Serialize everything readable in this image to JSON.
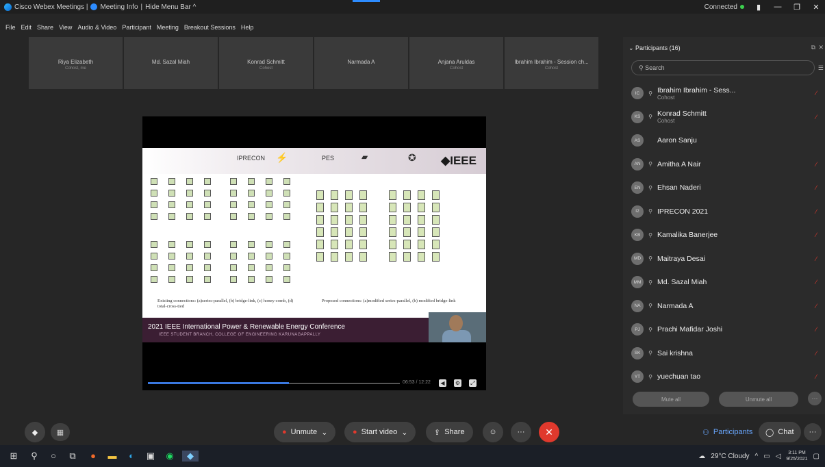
{
  "titlebar": {
    "app": "Cisco Webex Meetings |",
    "meeting_info": "Meeting Info",
    "sep": "|",
    "hide_menu": "Hide Menu Bar ^",
    "status": "Connected",
    "minimize": "—",
    "restore": "❐",
    "close": "✕"
  },
  "menu": [
    "File",
    "Edit",
    "Share",
    "View",
    "Audio & Video",
    "Participant",
    "Meeting",
    "Breakout Sessions",
    "Help"
  ],
  "thumbnails": [
    {
      "name": "Riya Elizabeth",
      "role": "Cohost, me"
    },
    {
      "name": "Md. Sazal Miah",
      "role": ""
    },
    {
      "name": "Konrad Schmitt",
      "role": "Cohost"
    },
    {
      "name": "Narmada A",
      "role": ""
    },
    {
      "name": "Anjana Aruldas",
      "role": "Cohost"
    },
    {
      "name": "Ibrahim Ibrahim - Session ch...",
      "role": "Cohost"
    }
  ],
  "slide": {
    "logo_precon": "IPRECON",
    "logo_pes": "PES",
    "ieee": "◆IEEE",
    "caption_left": "Existing connections: (a)series-parallel, (b) bridge-link, (c) honey-comb, (d) total-cross-tied",
    "caption_right": "Proposed connections: (a)modified series-parallel, (b) modified bridge-link",
    "conference": "2021 IEEE International Power & Renewable Energy Conference",
    "branch": "IEEE STUDENT BRANCH, COLLEGE OF ENGINEERING KARUNAGAPPALLY"
  },
  "video": {
    "time": "06:53 / 12:22",
    "progress": 0.56
  },
  "panel": {
    "title": "Participants (16)",
    "search_placeholder": "Search",
    "participants": [
      {
        "initials": "IC",
        "name": "Ibrahim Ibrahim - Sess...",
        "role": "Cohost",
        "muted": true
      },
      {
        "initials": "KS",
        "name": "Konrad Schmitt",
        "role": "Cohost",
        "muted": true
      },
      {
        "initials": "AS",
        "name": "Aaron Sanju",
        "role": "",
        "muted": false
      },
      {
        "initials": "AN",
        "name": "Amitha A Nair",
        "role": "",
        "muted": true
      },
      {
        "initials": "EN",
        "name": "Ehsan Naderi",
        "role": "",
        "muted": true
      },
      {
        "initials": "I2",
        "name": "IPRECON 2021",
        "role": "",
        "muted": true
      },
      {
        "initials": "KB",
        "name": "Kamalika Banerjee",
        "role": "",
        "muted": true
      },
      {
        "initials": "MD",
        "name": "Maitraya Desai",
        "role": "",
        "muted": true
      },
      {
        "initials": "MM",
        "name": "Md. Sazal Miah",
        "role": "",
        "muted": true
      },
      {
        "initials": "NA",
        "name": "Narmada A",
        "role": "",
        "muted": true
      },
      {
        "initials": "PJ",
        "name": "Prachi Mafidar Joshi",
        "role": "",
        "muted": true
      },
      {
        "initials": "SK",
        "name": "Sai krishna",
        "role": "",
        "muted": true
      },
      {
        "initials": "YT",
        "name": "yuechuan tao",
        "role": "",
        "muted": true
      }
    ],
    "mute_all": "Mute all",
    "unmute_all": "Unmute all"
  },
  "controls": {
    "unmute": "Unmute",
    "start_video": "Start video",
    "share": "Share",
    "participants": "Participants",
    "chat": "Chat"
  },
  "taskbar": {
    "weather": "29°C Cloudy",
    "time": "3:11 PM",
    "date": "9/25/2021"
  }
}
